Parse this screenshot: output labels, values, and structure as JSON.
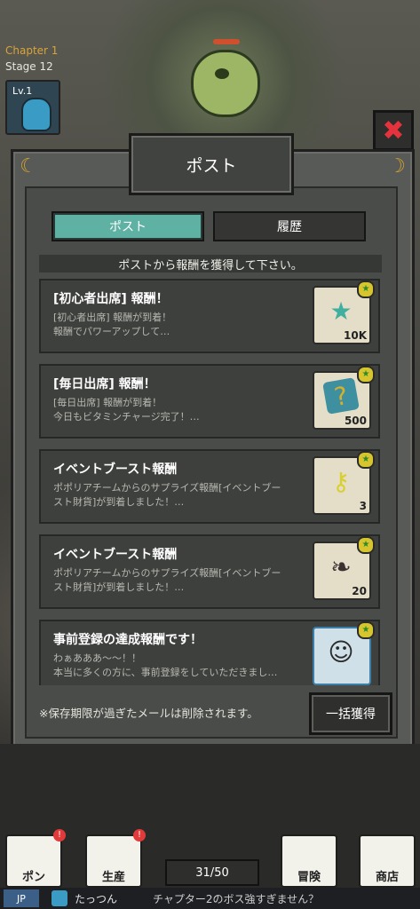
{
  "hud": {
    "chapter": "Chapter 1",
    "stage": "Stage 12",
    "level": "Lv.1"
  },
  "modal": {
    "title": "ポスト",
    "tabs": [
      {
        "label": "ポスト",
        "active": true
      },
      {
        "label": "履歴",
        "active": false
      }
    ],
    "banner": "ポストから報酬を獲得して下さい。",
    "mails": [
      {
        "title": "[初心者出席] 報酬！",
        "line1": "[初心者出席] 報酬が到着！",
        "line2": "報酬でパワーアップして…",
        "reward_icon": "star-icon",
        "quantity": "10K"
      },
      {
        "title": "[毎日出席] 報酬！",
        "line1": "[毎日出席] 報酬が到着！",
        "line2": "今日もビタミンチャージ完了！…",
        "reward_icon": "question-ticket-icon",
        "quantity": "500"
      },
      {
        "title": "イベントブースト報酬",
        "line1": "ポポリアチームからのサプライズ報酬[イベントブー",
        "line2": "スト財貨]が到着しました！…",
        "reward_icon": "key-icon",
        "quantity": "3"
      },
      {
        "title": "イベントブースト報酬",
        "line1": "ポポリアチームからのサプライズ報酬[イベントブー",
        "line2": "スト財貨]が到着しました！…",
        "reward_icon": "scroll-icon",
        "quantity": "20"
      },
      {
        "title": "事前登録の達成報酬です！",
        "line1": "わぁあああ〜〜！！",
        "line2": "本当に多くの方に、事前登録をしていただきまし…",
        "reward_icon": "character-portrait-icon",
        "quantity": ""
      }
    ],
    "note": "※保存期限が過ぎたメールは削除されます。",
    "collect_all": "一括獲得"
  },
  "nav": {
    "items": [
      "ポン",
      "生産",
      "冒険",
      "商店"
    ],
    "counter": "31/50"
  },
  "chat": {
    "lang": "JP",
    "user": "たっつん",
    "message": "チャプター2のボス強すぎません？"
  },
  "colors": {
    "accent_tab": "#5fb2a3",
    "close_red": "#e5333e",
    "chapter": "#d8a43a"
  }
}
